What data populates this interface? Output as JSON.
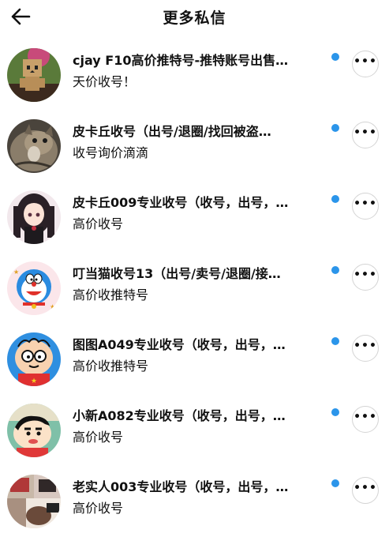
{
  "header": {
    "title": "更多私信",
    "back_icon": "arrow-left-icon"
  },
  "colors": {
    "unread_dot": "#2b95ea",
    "more_button_border": "#d4d4d4",
    "text": "#111111"
  },
  "conversations": [
    {
      "name": "cjay F10高价推特号-推特账号出售…",
      "preview": "天价收号！",
      "unread": true,
      "avatar": "cardboard-robot-avatar"
    },
    {
      "name": "皮卡丘收号（出号/退圈/找回被盗…",
      "preview": "收号询价滴滴",
      "unread": true,
      "avatar": "cat-avatar"
    },
    {
      "name": "皮卡丘009专业收号（收号，出号，…",
      "preview": "高价收号",
      "unread": true,
      "avatar": "anime-girl-avatar"
    },
    {
      "name": "叮当猫收号13（出号/卖号/退圈/接…",
      "preview": "高价收推特号",
      "unread": true,
      "avatar": "doraemon-avatar"
    },
    {
      "name": "图图A049专业收号（收号，出号，…",
      "preview": "高价收推特号",
      "unread": true,
      "avatar": "cartoon-boy-glasses-avatar"
    },
    {
      "name": "小新A082专业收号（收号，出号，…",
      "preview": "高价收号",
      "unread": true,
      "avatar": "shinchan-avatar"
    },
    {
      "name": "老实人003专业收号（收号，出号，…",
      "preview": "高价收号",
      "unread": true,
      "avatar": "photo-collage-avatar"
    }
  ],
  "more_icon": "more-horizontal-icon",
  "more_label": "•••"
}
